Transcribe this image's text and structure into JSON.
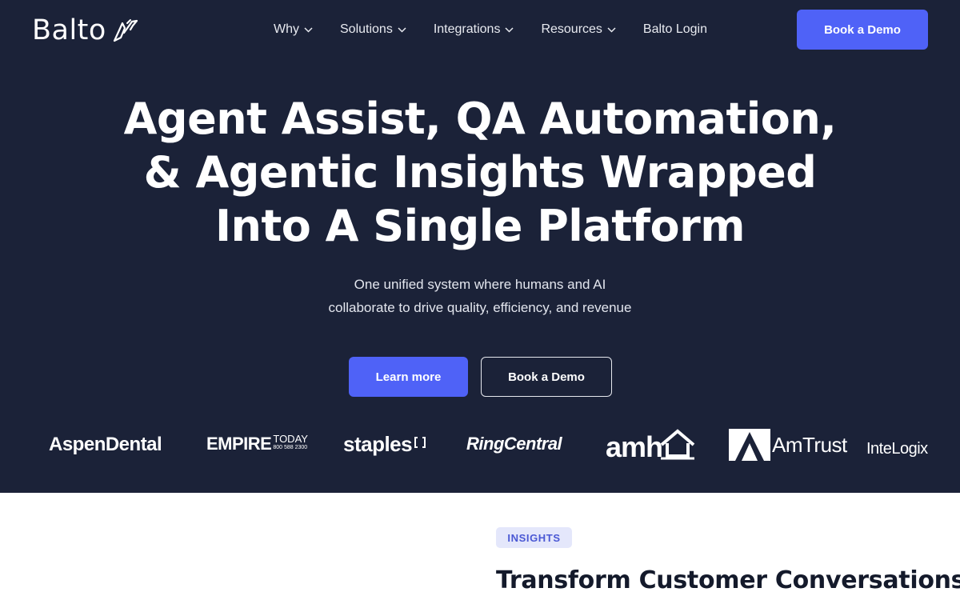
{
  "header": {
    "logo_text": "Balto",
    "nav": [
      {
        "label": "Why",
        "has_dropdown": true
      },
      {
        "label": "Solutions",
        "has_dropdown": true
      },
      {
        "label": "Integrations",
        "has_dropdown": true
      },
      {
        "label": "Resources",
        "has_dropdown": true
      },
      {
        "label": "Balto Login",
        "has_dropdown": false
      }
    ],
    "cta_label": "Book a Demo"
  },
  "hero": {
    "title_lines": [
      "Agent Assist, QA Automation,",
      "& Agentic Insights Wrapped",
      "Into A Single Platform"
    ],
    "subtitle_lines": [
      "One unified system where humans and AI",
      "collaborate to drive quality, efficiency, and revenue"
    ],
    "primary_cta": "Learn more",
    "secondary_cta": "Book a Demo"
  },
  "customer_logos": [
    {
      "name": "AspenDental",
      "icon": "aspen-dental-logo"
    },
    {
      "name": "EMPIRE",
      "tagline": "TODAY",
      "phone": "800 588 2300",
      "icon": "empire-today-logo"
    },
    {
      "name": "staples",
      "icon": "staples-logo"
    },
    {
      "name": "RingCentral",
      "icon": "ringcentral-logo"
    },
    {
      "name": "amh",
      "icon": "amh-house-logo"
    },
    {
      "name": "AmTrust",
      "icon": "amtrust-logo"
    },
    {
      "name": "InteLogix",
      "icon": "intelogix-logo"
    }
  ],
  "section": {
    "badge": "INSIGHTS",
    "title": "Transform Customer Conversations"
  },
  "colors": {
    "hero_bg": "#1b2238",
    "accent": "#4f62f7",
    "badge_bg": "#e4e7fb",
    "badge_text": "#4a58d4",
    "heading_dark": "#141a2b"
  }
}
